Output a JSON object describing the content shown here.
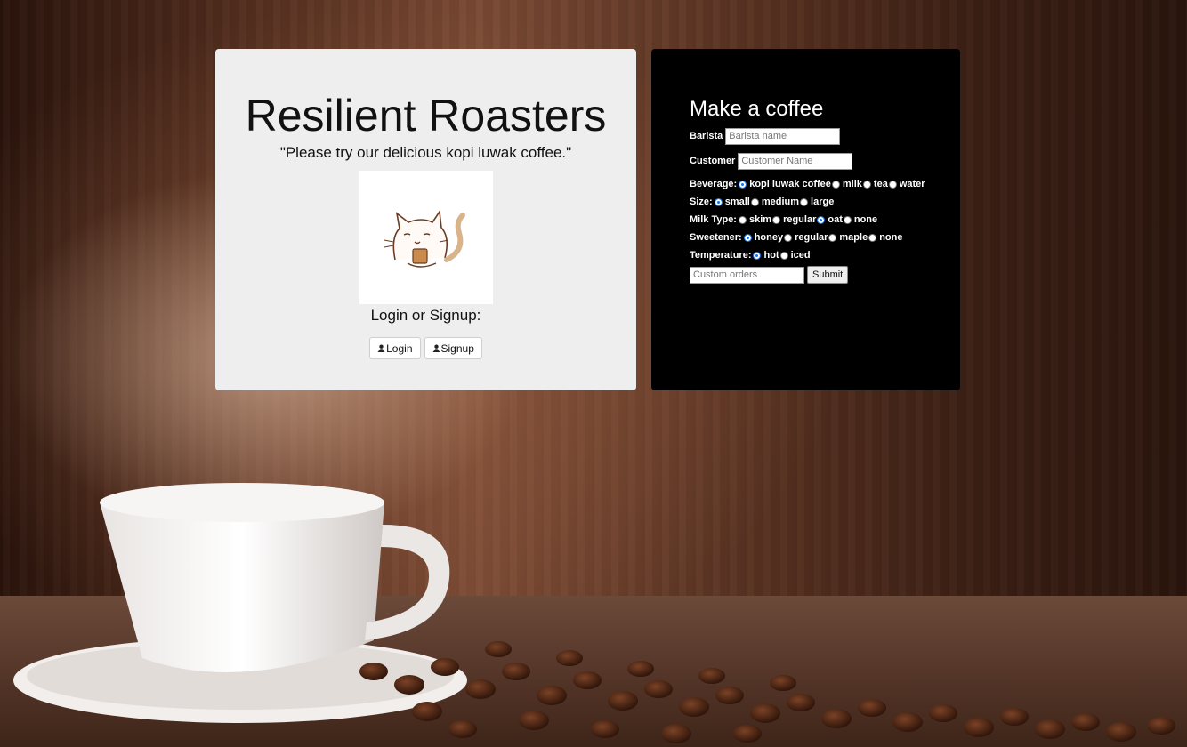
{
  "site": {
    "title": "Resilient Roasters",
    "tagline": "\"Please try our delicious kopi luwak coffee.\"",
    "logo_icon": "cat-with-coffee-icon",
    "login_prompt": "Login or Signup:",
    "login_label": "Login",
    "signup_label": "Signup",
    "user_icon": "user-icon"
  },
  "order_form": {
    "title": "Make a coffee",
    "barista": {
      "label": "Barista",
      "placeholder": "Barista name",
      "value": ""
    },
    "customer": {
      "label": "Customer",
      "placeholder": "Customer Name",
      "value": ""
    },
    "beverage": {
      "label": "Beverage:",
      "selected": "kopi luwak coffee",
      "options": [
        "kopi luwak coffee",
        "milk",
        "tea",
        "water"
      ]
    },
    "size": {
      "label": "Size:",
      "selected": "small",
      "options": [
        "small",
        "medium",
        "large"
      ]
    },
    "milk_type": {
      "label": "Milk Type:",
      "selected": "oat",
      "options": [
        "skim",
        "regular",
        "oat",
        "none"
      ]
    },
    "sweetener": {
      "label": "Sweetener:",
      "selected": "honey",
      "options": [
        "honey",
        "regular",
        "maple",
        "none"
      ]
    },
    "temperature": {
      "label": "Temperature:",
      "selected": "hot",
      "options": [
        "hot",
        "iced"
      ]
    },
    "custom_orders": {
      "placeholder": "Custom orders",
      "value": ""
    },
    "submit_label": "Submit"
  },
  "colors": {
    "left_card_bg": "#eeeeee",
    "right_card_bg": "#000000",
    "radio_selected": "#1a73e8"
  }
}
